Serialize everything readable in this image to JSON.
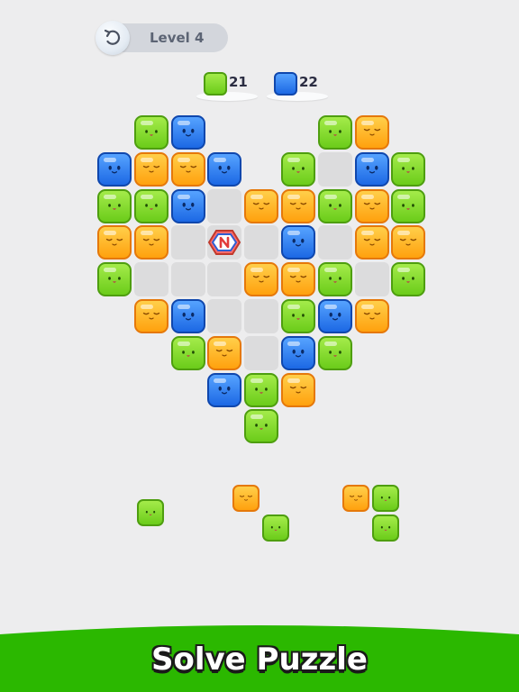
{
  "header": {
    "level_label": "Level 4",
    "undo_icon": "undo-icon"
  },
  "counters": [
    {
      "color": "green",
      "value": "21"
    },
    {
      "color": "blue",
      "value": "22"
    }
  ],
  "colors": {
    "green": "#7ed321",
    "blue": "#2f7ff0",
    "orange": "#ffab1a",
    "footer_green": "#2bb800",
    "background": "#ededee",
    "empty_slot": "#dcdcdd"
  },
  "board": {
    "rows": [
      [
        "",
        "G",
        "B",
        "",
        "",
        "",
        "G",
        "O",
        ""
      ],
      [
        "B",
        "O",
        "O",
        "B",
        "",
        "G",
        "_",
        "B",
        "G"
      ],
      [
        "G",
        "G",
        "B",
        "_",
        "O",
        "O",
        "G",
        "O",
        "G"
      ],
      [
        "O",
        "O",
        "_",
        "H",
        "_",
        "B",
        "_",
        "O",
        "O"
      ],
      [
        "G",
        "_",
        "_",
        "_",
        "O",
        "O",
        "G",
        "_",
        "G"
      ],
      [
        "",
        "O",
        "B",
        "_",
        "_",
        "G",
        "B",
        "O",
        ""
      ],
      [
        "",
        "",
        "G",
        "O",
        "_",
        "B",
        "G",
        "",
        ""
      ],
      [
        "",
        "",
        "",
        "B",
        "G",
        "O",
        "",
        "",
        ""
      ],
      [
        "",
        "",
        "",
        "",
        "G",
        "",
        "",
        "",
        ""
      ]
    ],
    "legend": {
      "G": "green",
      "B": "blue",
      "O": "orange",
      "_": "empty",
      "H": "hex-bomb"
    }
  },
  "tray": [
    "green",
    "orange",
    "green",
    "orange",
    "green",
    "green"
  ],
  "footer": {
    "title": "Solve Puzzle"
  }
}
